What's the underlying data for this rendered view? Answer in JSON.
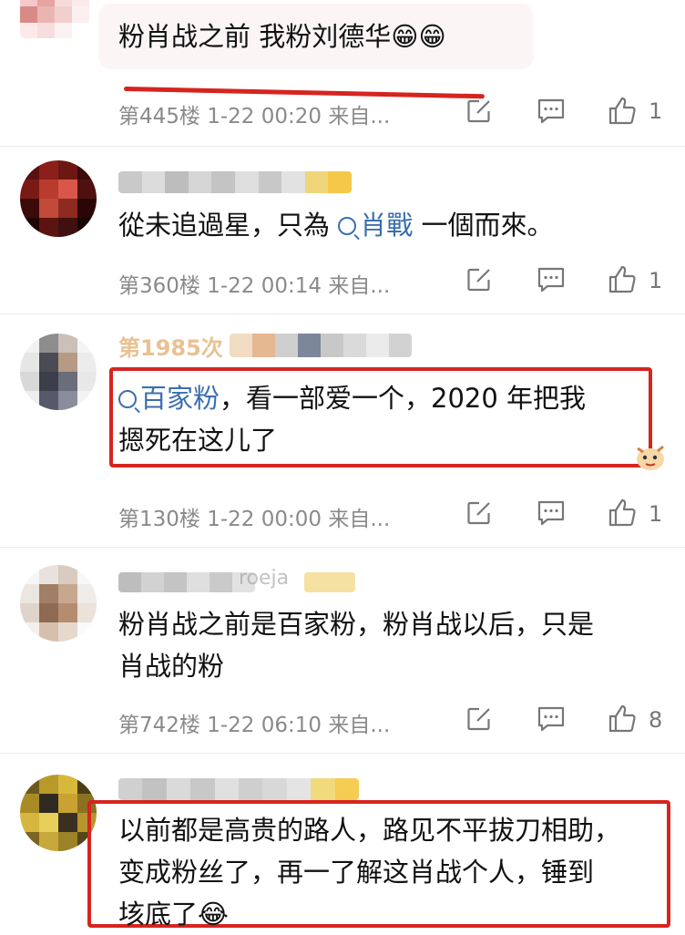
{
  "comments": [
    {
      "text": "粉肖战之前  我粉刘德华😁😁",
      "floor": "第445楼",
      "time": "1-22 00:20",
      "source": "来自...",
      "likes": "1"
    },
    {
      "text_before": "從未追過星，只為 ",
      "tag": "肖戰",
      "text_after": " 一個而來。",
      "floor": "第360楼",
      "time": "1-22 00:14",
      "source": "来自...",
      "likes": "1"
    },
    {
      "name_partial": "第1985次",
      "tag": "百家粉",
      "line1_after": "，看一部爱一个，2020 年把我",
      "line2": "摁死在这儿了",
      "floor": "第130楼",
      "time": "1-22 00:00",
      "source": "来自...",
      "likes": "1"
    },
    {
      "name_partial": "roeja",
      "line1": "粉肖战之前是百家粉，粉肖战以后，只是",
      "line2": "肖战的粉",
      "floor": "第742楼",
      "time": "1-22 06:10",
      "source": "来自...",
      "likes": "8"
    },
    {
      "line1": "以前都是高贵的路人，路见不平拔刀相助，",
      "line2": "变成粉丝了，再一了解这肖战个人，锤到",
      "line3": "垓底了😂"
    }
  ],
  "icons": {
    "reply": "edit-square-icon",
    "comment": "comment-bubble-icon",
    "like": "thumbs-up-icon",
    "search_tag": "search-icon"
  },
  "colors": {
    "link": "#3b6fb0",
    "highlight_border": "#d6241f",
    "meta": "#8a8a8a"
  }
}
